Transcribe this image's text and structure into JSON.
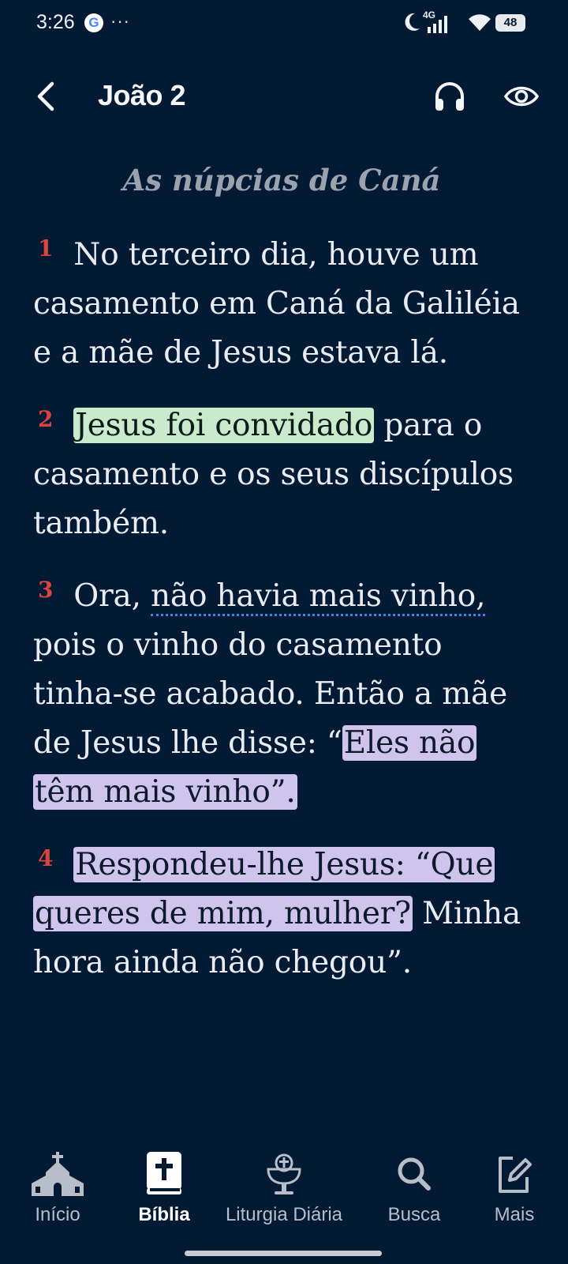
{
  "status_bar": {
    "time": "3:26",
    "google_badge": "G",
    "more": "···",
    "network": "4G",
    "battery": "48"
  },
  "header": {
    "title": "João 2",
    "back_icon": "chevron-left-icon",
    "audio_icon": "headphones-icon",
    "view_icon": "eye-icon"
  },
  "passage": {
    "section_heading": "As núpcias de Caná",
    "verses": [
      {
        "number": "1",
        "text": "No terceiro dia, houve um casamento em Caná da Galiléia e a mãe de Jesus estava lá."
      },
      {
        "number": "2",
        "highlight": "Jesus foi convidado",
        "text_after": " para o casamento e os seus discípulos também."
      },
      {
        "number": "3",
        "text_before": "Ora, ",
        "underlined": "não havia mais vinho,",
        "text_mid": " pois o vinho do casamento tinha-se acabado. Então a mãe de Jesus lhe disse: “",
        "highlight": "Eles não têm mais vinho”."
      },
      {
        "number": "4",
        "highlight": "Respondeu-lhe Jesus: “Que queres de mim, mulher?",
        "text_after": " Minha hora ainda não chegou”."
      }
    ]
  },
  "colors": {
    "background": "#031a34",
    "verse_number": "#d9443c",
    "highlight_green": "#c9ebcc",
    "highlight_purple": "#cfc4ec",
    "underline": "#3b86e8"
  },
  "bottom_nav": {
    "items": [
      {
        "label": "Início",
        "icon": "church-icon",
        "active": false
      },
      {
        "label": "Bíblia",
        "icon": "bible-icon",
        "active": true
      },
      {
        "label": "Liturgia Diária",
        "icon": "chalice-icon",
        "active": false
      },
      {
        "label": "Busca",
        "icon": "search-icon",
        "active": false
      },
      {
        "label": "Mais",
        "icon": "edit-icon",
        "active": false
      }
    ]
  }
}
